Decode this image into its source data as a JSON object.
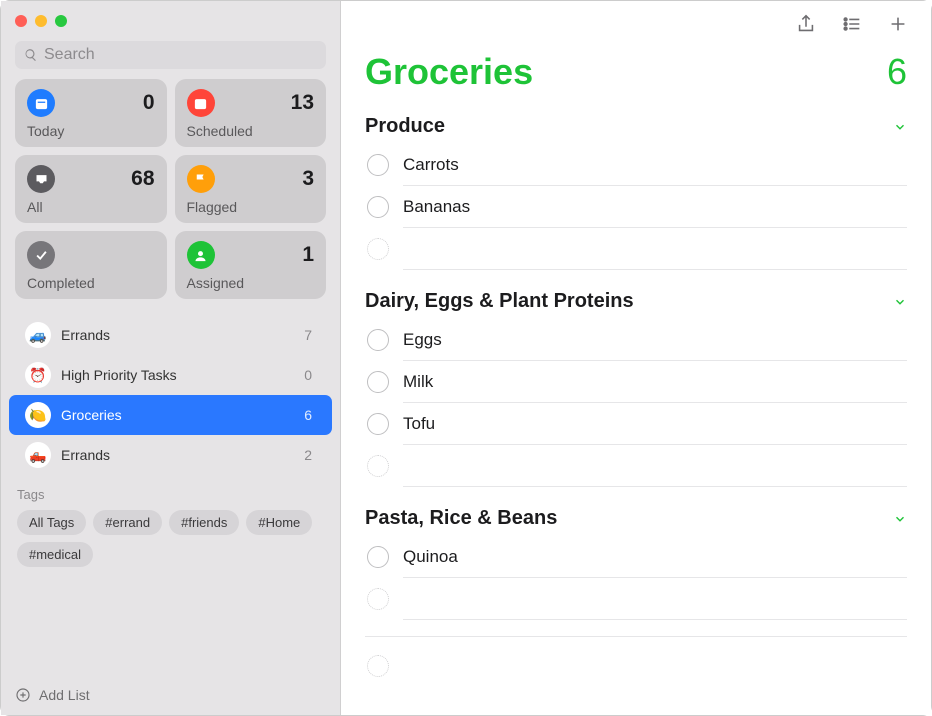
{
  "search": {
    "placeholder": "Search"
  },
  "smart": [
    {
      "id": "today",
      "label": "Today",
      "count": 0,
      "color": "#1f7cff"
    },
    {
      "id": "scheduled",
      "label": "Scheduled",
      "count": 13,
      "color": "#ff4539"
    },
    {
      "id": "all",
      "label": "All",
      "count": 68,
      "color": "#5c5b5f"
    },
    {
      "id": "flagged",
      "label": "Flagged",
      "count": 3,
      "color": "#ff9f0a"
    },
    {
      "id": "completed",
      "label": "Completed",
      "count": "",
      "color": "#77767a"
    },
    {
      "id": "assigned",
      "label": "Assigned",
      "count": 1,
      "color": "#1ec337"
    }
  ],
  "lists": [
    {
      "id": "errands1",
      "name": "Errands",
      "count": 7,
      "emoji": "🚙",
      "selected": false
    },
    {
      "id": "highpri",
      "name": "High Priority Tasks",
      "count": 0,
      "emoji": "⏰",
      "selected": false
    },
    {
      "id": "grocery",
      "name": "Groceries",
      "count": 6,
      "emoji": "🍋",
      "selected": true
    },
    {
      "id": "errands2",
      "name": "Errands",
      "count": 2,
      "emoji": "🛻",
      "selected": false
    }
  ],
  "tags": {
    "header": "Tags",
    "items": [
      "All Tags",
      "#errand",
      "#friends",
      "#Home",
      "#medical"
    ]
  },
  "addlist": "Add List",
  "main": {
    "title": "Groceries",
    "total": 6,
    "sections": [
      {
        "name": "Produce",
        "items": [
          "Carrots",
          "Bananas"
        ]
      },
      {
        "name": "Dairy, Eggs & Plant Proteins",
        "items": [
          "Eggs",
          "Milk",
          "Tofu"
        ]
      },
      {
        "name": "Pasta, Rice & Beans",
        "items": [
          "Quinoa"
        ]
      }
    ]
  }
}
